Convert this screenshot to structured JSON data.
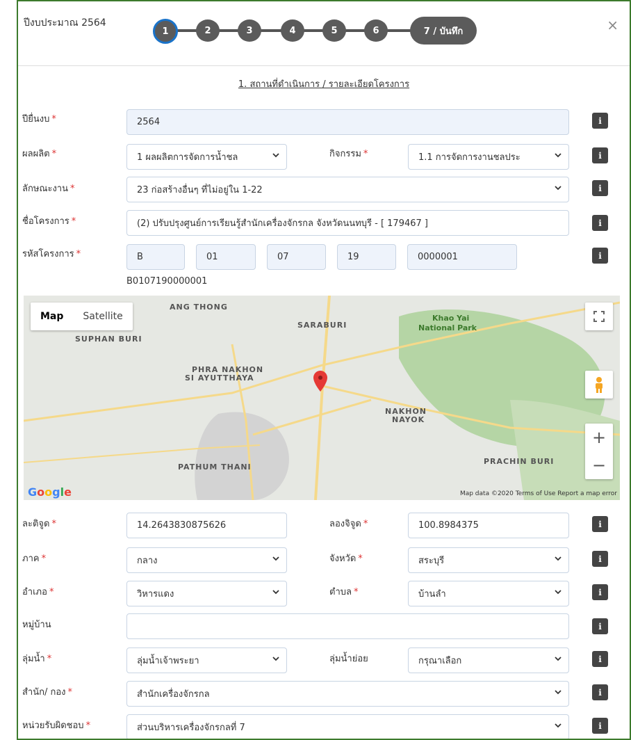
{
  "header": {
    "year_label": "ปีงบประมาณ 2564",
    "close_symbol": "×",
    "steps": [
      "1",
      "2",
      "3",
      "4",
      "5",
      "6",
      "7 / บันทึก"
    ],
    "active_step": 1
  },
  "section_title": "1. สถานที่ดำเนินการ / รายละเอียดโครงการ",
  "info_symbol": "i",
  "form": {
    "year": {
      "label": "ปียื่นงบ",
      "value": "2564"
    },
    "product": {
      "label": "ผลผลิต",
      "value": "1 ผลผลิตการจัดการน้ำชล"
    },
    "activity": {
      "label": "กิจกรรม",
      "value": "1.1 การจัดการงานชลประ"
    },
    "work_type": {
      "label": "ลักษณะงาน",
      "value": "23 ก่อสร้างอื่นๆ ที่ไม่อยู่ใน 1-22"
    },
    "project_name": {
      "label": "ชื่อโครงการ",
      "value": "(2) ปรับปรุงศูนย์การเรียนรู้สำนักเครื่องจักรกล จังหวัดนนทบุรี - [ 179467 ]"
    },
    "project_code": {
      "label": "รหัสโครงการ",
      "parts": [
        "B",
        "01",
        "07",
        "19",
        "0000001"
      ],
      "full": "B0107190000001"
    },
    "latitude": {
      "label": "ละติจูด",
      "value": "14.2643830875626"
    },
    "longitude": {
      "label": "ลองจิจูด",
      "value": "100.8984375"
    },
    "region": {
      "label": "ภาค",
      "value": "กลาง"
    },
    "province": {
      "label": "จังหวัด",
      "value": "สระบุรี"
    },
    "district": {
      "label": "อำเภอ",
      "value": "วิหารแดง"
    },
    "subdistrict": {
      "label": "ตำบล",
      "value": "บ้านลำ"
    },
    "village": {
      "label": "หมู่บ้าน",
      "value": ""
    },
    "basin": {
      "label": "ลุ่มน้ำ",
      "value": "ลุ่มน้ำเจ้าพระยา"
    },
    "sub_basin": {
      "label": "ลุ่มน้ำย่อย",
      "value": "กรุณาเลือก"
    },
    "office": {
      "label": "สำนัก/ กอง",
      "value": "สำนักเครื่องจักรกล"
    },
    "responsible": {
      "label": "หน่วยรับผิดชอบ",
      "value": "ส่วนบริหารเครื่องจักรกลที่ 7"
    }
  },
  "map": {
    "tab_map": "Map",
    "tab_satellite": "Satellite",
    "places": [
      "ANG THONG",
      "SARABURI",
      "SUPHAN BURI",
      "Khao Yai",
      "National Park",
      "PHRA NAKHON",
      "SI AYUTTHAYA",
      "NAKHON",
      "NAYOK",
      "PATHUM THANI",
      "PRACHIN BURI"
    ],
    "zoom_in": "+",
    "zoom_out": "−",
    "attribution": "Map data ©2020   Terms of Use   Report a map error",
    "google": "Google",
    "colors": {
      "park": "#b5d5a5",
      "road": "#f5d98a",
      "city": "#d3d3d3"
    }
  }
}
